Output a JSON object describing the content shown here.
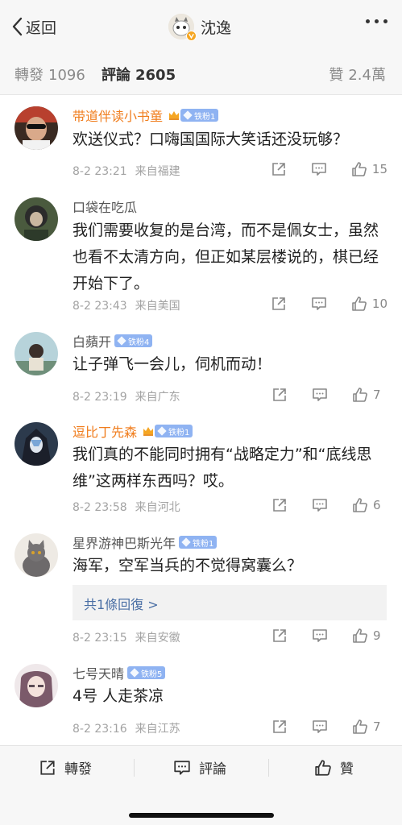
{
  "nav": {
    "back_label": "返回",
    "title": "沈逸"
  },
  "tabs": {
    "repost_label": "轉發",
    "repost_count": "1096",
    "comment_label": "評論",
    "comment_count": "2605",
    "like_label": "贊",
    "like_count": "2.4萬"
  },
  "comments": [
    {
      "name": "带道伴读小书童",
      "badge": "铁粉1",
      "text": "欢送仪式？口嗨国国际大笑话还没玩够？",
      "date": "8-2 23:21",
      "location": "来自福建",
      "likes": "15"
    },
    {
      "name": "口袋在吃瓜",
      "text": "我们需要收复的是台湾，而不是佩女士，虽然也看不太清方向，但正如某层楼说的，棋已经开始下了。",
      "date": "8-2 23:43",
      "location": "来自美国",
      "likes": "10"
    },
    {
      "name": "白蘋开",
      "badge": "铁粉4",
      "text": "让子弹飞一会儿，伺机而动！",
      "date": "8-2 23:19",
      "location": "来自广东",
      "likes": "7"
    },
    {
      "name": "逗比丁先森",
      "badge": "铁粉1",
      "text": "我们真的不能同时拥有“战略定力”和“底线思维”这两样东西吗？哎。",
      "date": "8-2 23:58",
      "location": "来自河北",
      "likes": "6"
    },
    {
      "name": "星界游神巴斯光年",
      "badge": "铁粉1",
      "text": "海军，空军当兵的不觉得窝囊么？",
      "replies_label": "共1條回復 >",
      "date": "8-2 23:15",
      "location": "来自安徽",
      "likes": "9"
    },
    {
      "name": "七号天晴",
      "badge": "铁粉5",
      "text": "4号 人走茶凉",
      "date": "8-2 23:16",
      "location": "来自江苏",
      "likes": "7"
    }
  ],
  "bottom": {
    "repost_label": "轉發",
    "comment_label": "評論",
    "like_label": "贊"
  },
  "colors": {
    "vip_name": "#f07d1d",
    "fan_badge": "#8fb3f2",
    "link": "#4a6fa5"
  }
}
